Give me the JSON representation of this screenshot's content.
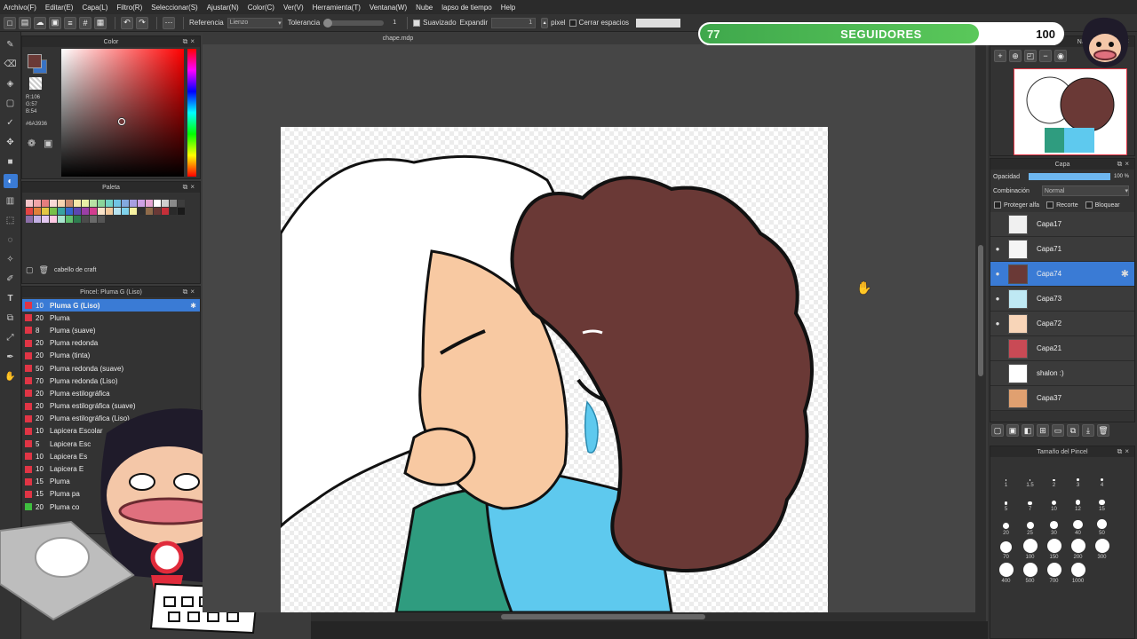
{
  "menu": [
    "Archivo(F)",
    "Editar(E)",
    "Capa(L)",
    "Filtro(R)",
    "Seleccionar(S)",
    "Ajustar(N)",
    "Color(C)",
    "Ver(V)",
    "Herramienta(T)",
    "Ventana(W)",
    "Nube",
    "lapso de tiempo",
    "Help"
  ],
  "toolbar": {
    "referencia_label": "Referencia",
    "referencia_value": "Lienzo",
    "tolerancia_label": "Tolerancia",
    "tolerancia_value": "1",
    "suavizado_label": "Suavizado",
    "expandir_label": "Expandir",
    "expandir_value": "1",
    "pixel_label": "pixel",
    "cerrar_label": "Cerrar espacios"
  },
  "document_tab": "chape.mdp",
  "color_panel": {
    "title": "Color",
    "r": "R:106",
    "g": "G:57",
    "b": "B:54",
    "hex": "#6A3936",
    "current_color": "#6A3936"
  },
  "palette_panel": {
    "title": "Paleta",
    "layer_hint": "cabello de craft",
    "colors": [
      "#f3c4c8",
      "#f0a4a8",
      "#e57d7f",
      "#f7d9d5",
      "#f6d3b0",
      "#c98b6f",
      "#f7e7a8",
      "#e9f0a6",
      "#b8e1a4",
      "#8ad59a",
      "#72d2c5",
      "#70c4e4",
      "#83a9df",
      "#a89fe1",
      "#cfa1e4",
      "#e6a6d3",
      "#ffffff",
      "#cfcfcf",
      "#8a8a8a",
      "#3d3d3d",
      "#e24444",
      "#e0803a",
      "#e3c844",
      "#78c04a",
      "#39a3a0",
      "#3366cc",
      "#5c46b0",
      "#9b3fa6",
      "#d43d8f",
      "#fae3c9",
      "#f2c89c",
      "#b7e3f0",
      "#7fd2ec",
      "#f7f1a1",
      "#2f2f2f",
      "#8f6b4a",
      "#6a3936",
      "#c62f39",
      "#2a2a2a",
      "#1a1a1a",
      "#8c6fa8",
      "#c4b0e4",
      "#e3c8f0",
      "#ffc9e3",
      "#a8e6cf",
      "#5fbf6e",
      "#2e7d4f",
      "#4b4b4b",
      "#6a6a6a",
      "#555555"
    ]
  },
  "brush_panel": {
    "title": "Pincel: Pluma G (Liso)",
    "items": [
      {
        "size": "10",
        "name": "Pluma G (Liso)",
        "color": "#e03545"
      },
      {
        "size": "20",
        "name": "Pluma",
        "color": "#e03545"
      },
      {
        "size": "8",
        "name": "Pluma (suave)",
        "color": "#e03545"
      },
      {
        "size": "20",
        "name": "Pluma redonda",
        "color": "#e03545"
      },
      {
        "size": "20",
        "name": "Pluma (tinta)",
        "color": "#e03545"
      },
      {
        "size": "50",
        "name": "Pluma redonda (suave)",
        "color": "#e03545"
      },
      {
        "size": "70",
        "name": "Pluma redonda (Liso)",
        "color": "#e03545"
      },
      {
        "size": "20",
        "name": "Pluma estilográfica",
        "color": "#e03545"
      },
      {
        "size": "20",
        "name": "Pluma estilográfica (suave)",
        "color": "#e03545"
      },
      {
        "size": "20",
        "name": "Pluma estilográfica (Liso)",
        "color": "#e03545"
      },
      {
        "size": "10",
        "name": "Lapicera Escolar",
        "color": "#e03545"
      },
      {
        "size": "5",
        "name": "Lapicera Esc",
        "color": "#e03545"
      },
      {
        "size": "10",
        "name": "Lapicera Es",
        "color": "#e03545"
      },
      {
        "size": "10",
        "name": "Lapicera E",
        "color": "#e03545"
      },
      {
        "size": "15",
        "name": "Pluma",
        "color": "#e03545"
      },
      {
        "size": "15",
        "name": "Pluma pa",
        "color": "#e03545"
      },
      {
        "size": "20",
        "name": "Pluma co",
        "color": "#3fbf3f"
      }
    ]
  },
  "followers_bar": {
    "current": "77",
    "label": "SEGUIDORES",
    "goal": "100",
    "fill": 0.77
  },
  "navigator": {
    "title": "Navegador"
  },
  "layer_panel": {
    "title": "Capa",
    "opacity_label": "Opacidad",
    "opacity_value": "100 %",
    "opacity": 1.0,
    "blend_label": "Combinación",
    "blend_value": "Normal",
    "protect_alpha": "Proteger alfa",
    "clipping": "Recorte",
    "lock": "Bloquear",
    "layers": [
      {
        "name": "Capa17",
        "visible": false,
        "active": false,
        "thumb": "#f0f0f0"
      },
      {
        "name": "Capa71",
        "visible": true,
        "active": false,
        "thumb": "#f5f5f5"
      },
      {
        "name": "Capa74",
        "visible": true,
        "active": true,
        "thumb": "#6a3936"
      },
      {
        "name": "Capa73",
        "visible": true,
        "active": false,
        "thumb": "#bfe9f4"
      },
      {
        "name": "Capa72",
        "visible": true,
        "active": false,
        "thumb": "#f8d5b8"
      },
      {
        "name": "Capa21",
        "visible": false,
        "active": false,
        "thumb": "#c94a55"
      },
      {
        "name": "shalon :)",
        "visible": false,
        "active": false,
        "thumb": "#ffffff"
      },
      {
        "name": "Capa37",
        "visible": false,
        "active": false,
        "thumb": "#e0a070"
      }
    ]
  },
  "brush_size_panel": {
    "title": "Tamaño del Pincel",
    "sizes": [
      "1",
      "1.5",
      "2",
      "3",
      "4",
      "5",
      "7",
      "10",
      "12",
      "15",
      "20",
      "25",
      "30",
      "40",
      "50",
      "70",
      "100",
      "150",
      "200",
      "300",
      "400",
      "500",
      "700",
      "1000"
    ]
  }
}
